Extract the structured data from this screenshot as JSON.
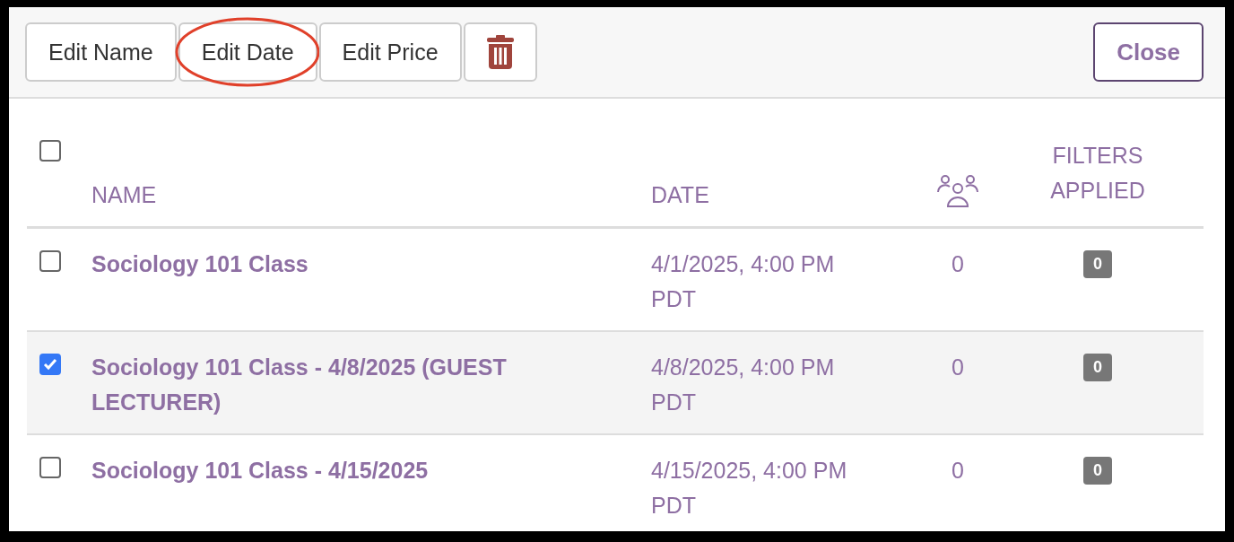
{
  "toolbar": {
    "buttons": [
      {
        "kind": "text",
        "label": "Edit Name",
        "circled": false
      },
      {
        "kind": "text",
        "label": "Edit Date",
        "circled": true
      },
      {
        "kind": "text",
        "label": "Edit Price",
        "circled": false
      },
      {
        "kind": "delete",
        "circled": false
      }
    ],
    "close": "Close"
  },
  "table": {
    "select_all_checked": false,
    "columns": [
      "NAME",
      "DATE",
      "FILTERS APPLIED"
    ],
    "rows": [
      {
        "name": "Sociology 101 Class",
        "date": "4/1/2025, 4:00 PM PDT",
        "count": "0",
        "filters": "0",
        "checked": false
      },
      {
        "name": "Sociology 101 Class - 4/8/2025 (GUEST LECTURER)",
        "date": "4/8/2025, 4:00 PM PDT",
        "count": "0",
        "filters": "0",
        "checked": true
      },
      {
        "name": "Sociology 101 Class - 4/15/2025",
        "date": "4/15/2025, 4:00 PM PDT",
        "count": "0",
        "filters": "0",
        "checked": false
      }
    ]
  }
}
